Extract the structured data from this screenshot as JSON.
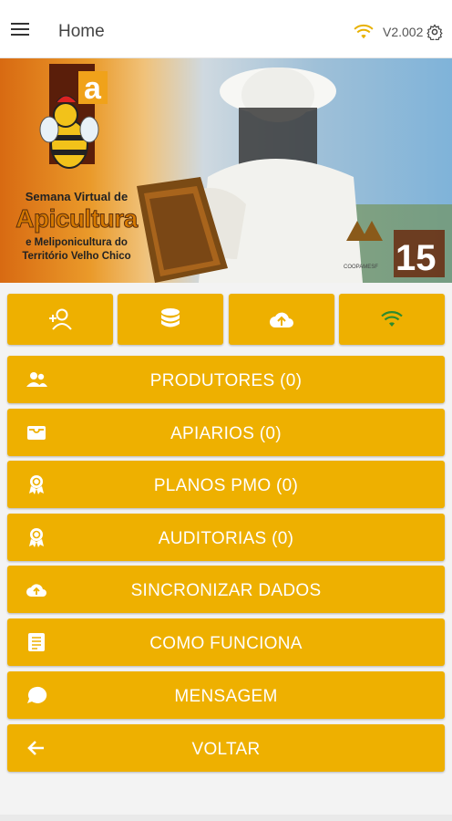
{
  "appbar": {
    "title": "Home",
    "version": "V2.002",
    "icons": [
      "menu-icon",
      "wifi-icon",
      "gear-icon"
    ]
  },
  "banner": {
    "line1": "Semana Virtual de",
    "line2": "Apicultura",
    "line3": "e Meliponicultura do",
    "line4": "Território Velho Chico",
    "logo_letter": "a",
    "org_badge": "15",
    "org_name": "COOPAMESF"
  },
  "quick_actions": [
    {
      "icon": "add-person-icon"
    },
    {
      "icon": "database-icon"
    },
    {
      "icon": "cloud-upload-icon"
    },
    {
      "icon": "wifi-icon"
    }
  ],
  "menu": [
    {
      "label": "PRODUTORES (0)",
      "icon": "people-icon"
    },
    {
      "label": "APIARIOS (0)",
      "icon": "box-icon"
    },
    {
      "label": "PLANOS PMO (0)",
      "icon": "award-icon"
    },
    {
      "label": "AUDITORIAS (0)",
      "icon": "award-icon"
    },
    {
      "label": "SINCRONIZAR DADOS",
      "icon": "cloud-upload-icon"
    },
    {
      "label": "COMO FUNCIONA",
      "icon": "document-icon"
    },
    {
      "label": "MENSAGEM",
      "icon": "chat-icon"
    },
    {
      "label": "VOLTAR",
      "icon": "arrow-left-icon"
    }
  ],
  "colors": {
    "accent": "#eeb000",
    "wifi_top": "#e8b100",
    "wifi_quick": "#2e8b2e"
  }
}
